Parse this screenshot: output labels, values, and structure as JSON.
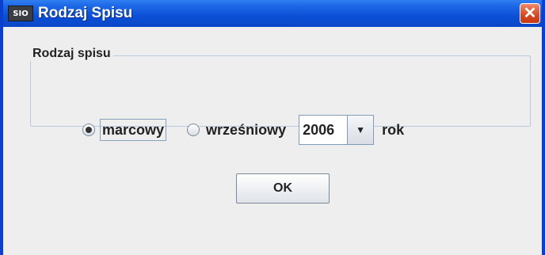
{
  "window": {
    "title": "Rodzaj Spisu",
    "icon_text": "SIO",
    "close_glyph": "✕"
  },
  "group": {
    "legend": "Rodzaj spisu",
    "options": [
      {
        "label": "marcowy",
        "selected": true
      },
      {
        "label": "wrześniowy",
        "selected": false
      }
    ],
    "year_select": {
      "value": "2006",
      "arrow_icon": "chevron-down-icon"
    },
    "year_suffix": "rok"
  },
  "actions": {
    "ok_label": "OK"
  },
  "colors": {
    "title_bar": "#0b4fd6",
    "close_button": "#d9461f",
    "background": "#eeeeee"
  }
}
